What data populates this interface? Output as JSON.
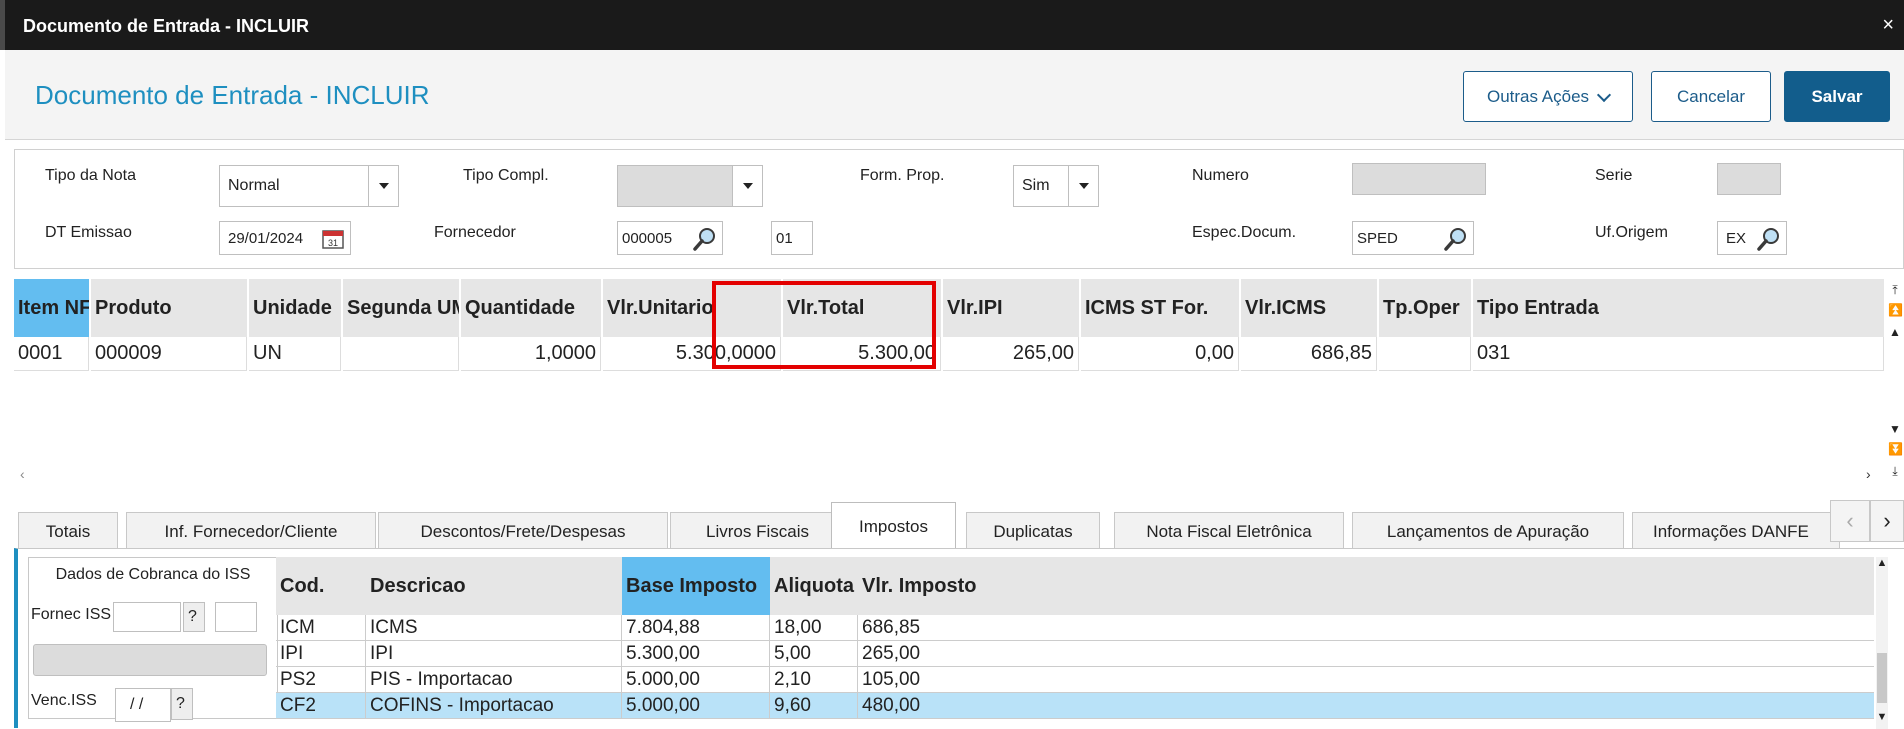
{
  "window": {
    "title": "Documento de Entrada - INCLUIR",
    "close": "×"
  },
  "header": {
    "title": "Documento de Entrada - INCLUIR",
    "outras": "Outras Ações",
    "cancelar": "Cancelar",
    "salvar": "Salvar"
  },
  "form": {
    "tipo_nota_label": "Tipo da Nota",
    "tipo_nota_value": "Normal",
    "tipo_compl_label": "Tipo Compl.",
    "tipo_compl_value": "",
    "form_prop_label": "Form. Prop.",
    "form_prop_value": "Sim",
    "numero_label": "Numero",
    "numero_value": "",
    "serie_label": "Serie",
    "serie_value": "",
    "dt_emissao_label": "DT Emissao",
    "dt_emissao_value": "29/01/2024",
    "fornecedor_label": "Fornecedor",
    "fornecedor_value": "000005",
    "loja_value": "01",
    "espec_label": "Espec.Docum.",
    "espec_value": "SPED",
    "uf_label": "Uf.Origem",
    "uf_value": "EX"
  },
  "grid": {
    "headers": [
      "Item NF",
      "Produto",
      "Unidade",
      "Segunda UM",
      "Quantidade",
      "Vlr.Unitario",
      "Vlr.Total",
      "Vlr.IPI",
      "ICMS ST For.",
      "Vlr.ICMS",
      "Tp.Oper",
      "Tipo Entrada"
    ],
    "row": [
      "0001",
      "000009",
      "UN",
      "",
      "1,0000",
      "5.300,0000",
      "5.300,00",
      "265,00",
      "0,00",
      "686,85",
      "",
      "031"
    ]
  },
  "tabs": [
    "Totais",
    "Inf. Fornecedor/Cliente",
    "Descontos/Frete/Despesas",
    "Livros Fiscais",
    "Impostos",
    "Duplicatas",
    "Nota Fiscal Eletrônica",
    "Lançamentos de Apuração",
    "Informações DANFE"
  ],
  "active_tab": "Impostos",
  "iss": {
    "title": "Dados de Cobranca do ISS",
    "fornec_label": "Fornec ISS",
    "venc_label": "Venc.ISS",
    "venc_value": "/ /",
    "q": "?"
  },
  "taxes": {
    "headers": [
      "Cod.",
      "Descricao",
      "Base Imposto",
      "Aliquota",
      "Vlr. Imposto"
    ],
    "rows": [
      [
        "ICM",
        "ICMS",
        "7.804,88",
        "18,00",
        "686,85"
      ],
      [
        "IPI",
        "IPI",
        "5.300,00",
        "5,00",
        "265,00"
      ],
      [
        "PS2",
        "PIS - Importacao",
        "5.000,00",
        "2,10",
        "105,00"
      ],
      [
        "CF2",
        "COFINS - Importacao",
        "5.000,00",
        "9,60",
        "480,00"
      ]
    ]
  },
  "colors": {
    "accent": "#1e8fc0",
    "primary_button": "#125d8c",
    "selected_header": "#63bdf0",
    "highlight_row": "#b9e2f8",
    "red_box": "#e30000"
  }
}
